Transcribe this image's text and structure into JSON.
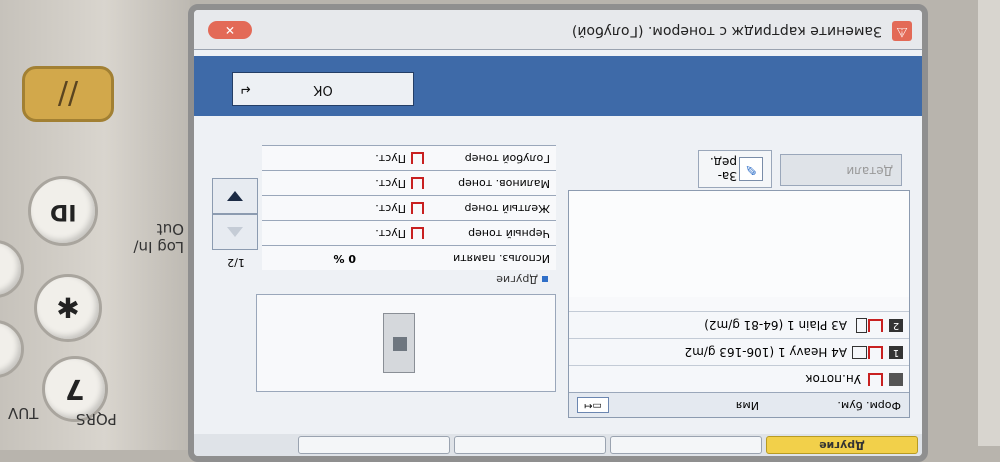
{
  "device": {
    "reset_label": "//",
    "id_label": "ID",
    "login_label": "Log In/ Out",
    "key_star": "✱",
    "key_7": "7",
    "key_7_letters": "PQRS",
    "key_8_letters": "TUV"
  },
  "titlebar": {
    "message": "Замените картридж с тонером. (Голубой)",
    "warn_icon": "warning-icon"
  },
  "dialog": {
    "ok_label": "ОК",
    "details_label": "Детали",
    "replace_label": "За- ред."
  },
  "paper": {
    "header_col1": "Форм. бум.",
    "header_col2": "Имя",
    "rows": [
      {
        "num": "",
        "text": "Ун.поток"
      },
      {
        "num": "1",
        "text": "A4   Heavy 1 (106-163 g/m2"
      },
      {
        "num": "2",
        "text": "A3   Plain 1 (64-81 g/m2)"
      }
    ]
  },
  "status": {
    "section_label": "Другие",
    "items": [
      {
        "label": "Использ. памяти",
        "value": "0 %"
      },
      {
        "label": "Черный тонер",
        "value": "Пуст."
      },
      {
        "label": "Желтый тонер",
        "value": "Пуст."
      },
      {
        "label": "Малинов. тонер",
        "value": "Пуст."
      },
      {
        "label": "Голубой тонер",
        "value": "Пуст."
      }
    ],
    "page": "1/2"
  },
  "tabs": {
    "other_label": "Другие"
  }
}
